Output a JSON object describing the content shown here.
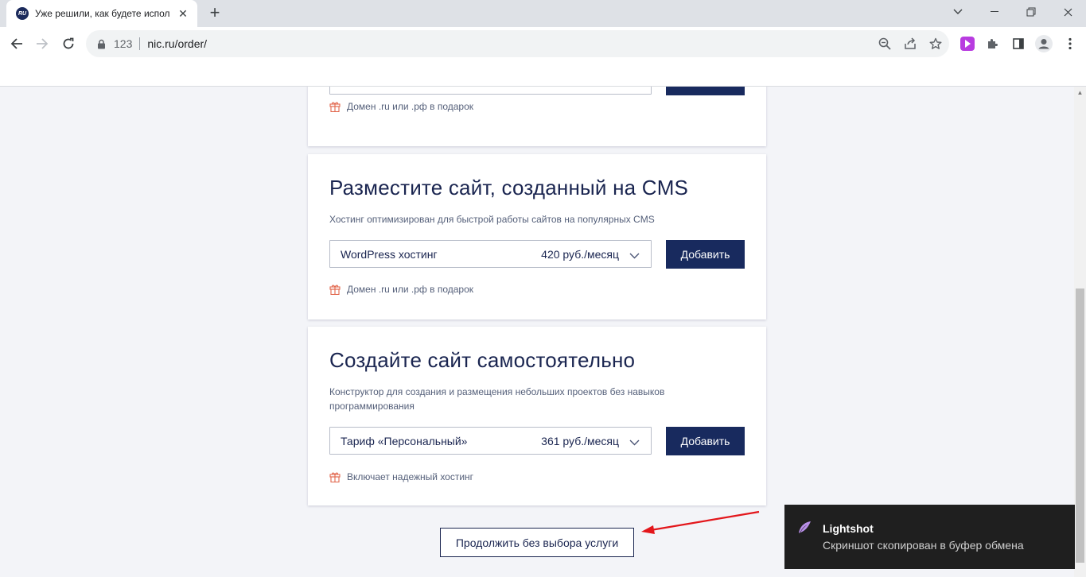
{
  "browser": {
    "tab_title": "Уже решили, как будете испол",
    "tab_favicon_text": "RU",
    "url_prefix": "123",
    "url": "nic.ru/order/"
  },
  "cards": [
    {
      "gift_text": "Домен .ru или .рф в подарок"
    },
    {
      "title": "Разместите сайт, созданный на CMS",
      "description": "Хостинг оптимизирован для быстрой работы сайтов на популярных CMS",
      "select_name": "WordPress хостинг",
      "select_price": "420 руб./месяц",
      "button": "Добавить",
      "gift_text": "Домен .ru или .рф в подарок"
    },
    {
      "title": "Создайте сайт самостоятельно",
      "description": "Конструктор для создания и размещения небольших проектов без навыков программирования",
      "select_name": "Тариф «Персональный»",
      "select_price": "361 руб./месяц",
      "button": "Добавить",
      "gift_text": "Включает надежный хостинг"
    }
  ],
  "continue_button": "Продолжить без выбора услуги",
  "toast": {
    "title": "Lightshot",
    "text": "Скриншот скопирован в буфер обмена"
  },
  "colors": {
    "accent": "#182a5e",
    "gift": "#e2674d",
    "annotation_arrow": "#e3161b"
  }
}
